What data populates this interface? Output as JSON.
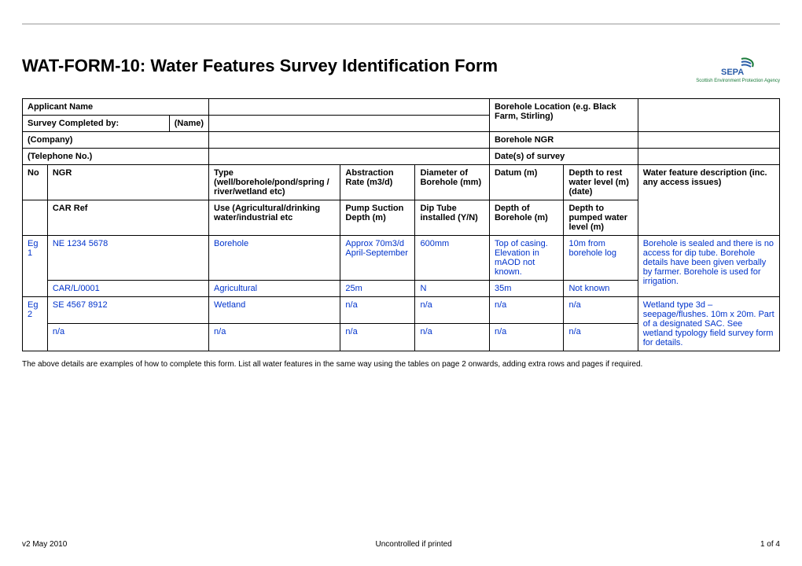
{
  "title": "WAT-FORM-10: Water Features Survey Identification Form",
  "logo": {
    "name": "SEPA",
    "sub": "Scottish Environment\nProtection Agency"
  },
  "labels": {
    "applicant": "Applicant Name",
    "surveyBy": "Survey Completed by:",
    "name": "(Name)",
    "company": "(Company)",
    "tel": "(Telephone No.)",
    "boreholeLoc": "Borehole Location (e.g. Black Farm, Stirling)",
    "boreholeNgr": "Borehole NGR",
    "dates": "Date(s) of survey"
  },
  "headers1": {
    "no": "No",
    "ngr": "NGR",
    "type": "Type (well/borehole/pond/spring / river/wetland etc)",
    "abstraction": "Abstraction Rate (m3/d)",
    "diameter": "Diameter of Borehole (mm)",
    "datum": "Datum (m)",
    "depthRest": "Depth to rest water level (m) (date)",
    "desc": "Water feature description (inc. any access issues)"
  },
  "headers2": {
    "carRef": "CAR Ref",
    "use": "Use (Agricultural/drinking water/industrial etc",
    "pump": "Pump Suction Depth (m)",
    "dipTube": "Dip Tube installed (Y/N)",
    "depthBore": "Depth of Borehole (m)",
    "depthPumped": "Depth to pumped water level (m)"
  },
  "eg1": {
    "no": "Eg 1",
    "ngr": "NE 1234 5678",
    "type": "Borehole",
    "abstraction": "Approx 70m3/d April-September",
    "diameter": "600mm",
    "datum": "Top of casing. Elevation in mAOD not known.",
    "depthRest": "10m from borehole log",
    "desc": "Borehole is sealed and there is no access for dip tube. Borehole details have been given verbally by farmer. Borehole is used for irrigation.",
    "carRef": "CAR/L/0001",
    "use": "Agricultural",
    "pump": "25m",
    "dipTube": "N",
    "depthBore": "35m",
    "depthPumped": "Not known"
  },
  "eg2": {
    "no": "Eg 2",
    "ngr": "SE 4567 8912",
    "type": "Wetland",
    "abstraction": "n/a",
    "diameter": "n/a",
    "datum": "n/a",
    "depthRest": "n/a",
    "desc": "Wetland type 3d – seepage/flushes. 10m x 20m. Part of a designated SAC. See wetland typology field survey form for details.",
    "carRef": "n/a",
    "use": "n/a",
    "pump": "n/a",
    "dipTube": "n/a",
    "depthBore": "n/a",
    "depthPumped": "n/a"
  },
  "footnote": "The above details are examples of how to complete this form. List all water features in the same way using the tables on page 2 onwards, adding extra rows and pages if required.",
  "footer": {
    "left": "v2  May 2010",
    "center": "Uncontrolled if printed",
    "right": "1 of 4"
  }
}
